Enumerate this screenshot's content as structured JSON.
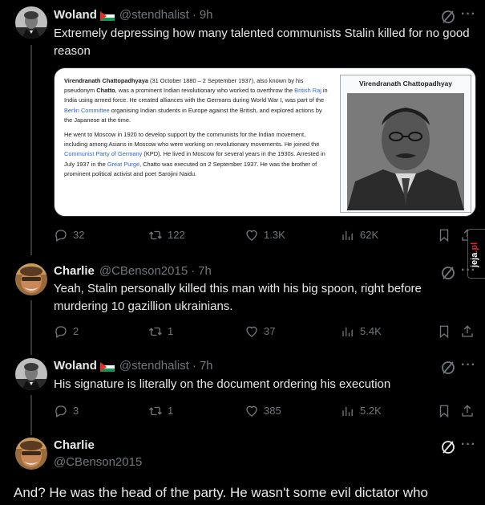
{
  "tweets": [
    {
      "name": "Woland",
      "handle": "@stendhalist",
      "time": "9h",
      "text": "Extremely depressing how many talented communists Stalin killed for no good reason",
      "actions": {
        "replies": "32",
        "reposts": "122",
        "likes": "1.3K",
        "views": "62K"
      }
    },
    {
      "name": "Charlie",
      "handle": "@CBenson2015",
      "time": "7h",
      "text": "Yeah, Stalin personally killed this man with his big spoon, right before murdering 10 gazillion ukrainians.",
      "actions": {
        "replies": "2",
        "reposts": "1",
        "likes": "37",
        "views": "5.4K"
      }
    },
    {
      "name": "Woland",
      "handle": "@stendhalist",
      "time": "7h",
      "text": "His signature is literally on the document ordering his execution",
      "actions": {
        "replies": "3",
        "reposts": "1",
        "likes": "385",
        "views": "5.2K"
      }
    },
    {
      "name": "Charlie",
      "handle": "@CBenson2015",
      "text": "And? He was the head of the party. He wasn't some evil dictator who"
    }
  ],
  "media": {
    "infobox_title": "Virendranath Chattopadhyay",
    "p1": {
      "name_bold": "Virendranath Chattopadhyaya",
      "a": " (31 October 1880 – 2 September 1937), also known by his pseudonym ",
      "alias_bold": "Chatto",
      "b": ", was a prominent Indian revolutionary who worked to overthrow the ",
      "link1": "British Raj",
      "c": " in India using armed force. He created alliances with the Germans during World War I, was part of the ",
      "link2": "Berlin Committee",
      "d": " organising Indian students in Europe against the British, and explored actions by the Japanese at the time."
    },
    "p2": {
      "a": "He went to Moscow in 1920 to develop support by the communists for the Indian movement, including among Asians in Moscow who were working on revolutionary movements. He joined the ",
      "link1": "Communist Party of Germany",
      "b": " (KPD). He lived in Moscow for several years in the 1930s. Arrested in July 1937 in the ",
      "link2": "Great Purge",
      "c": ", Chatto was executed on 2 September 1937. He was the brother of prominent political activist and poet Sarojini Naidu."
    }
  },
  "watermark": {
    "main": "jeja",
    "suffix": ".pl"
  },
  "icons": {
    "reply": "reply-icon",
    "repost": "repost-icon",
    "like": "like-icon",
    "views": "views-icon",
    "bookmark": "bookmark-icon",
    "share": "share-icon",
    "grok": "grok-icon",
    "more": "more-icon"
  },
  "colors": {
    "background": "#000000",
    "text": "#e7e9ea",
    "secondary": "#71767b",
    "link": "#3366cc"
  }
}
